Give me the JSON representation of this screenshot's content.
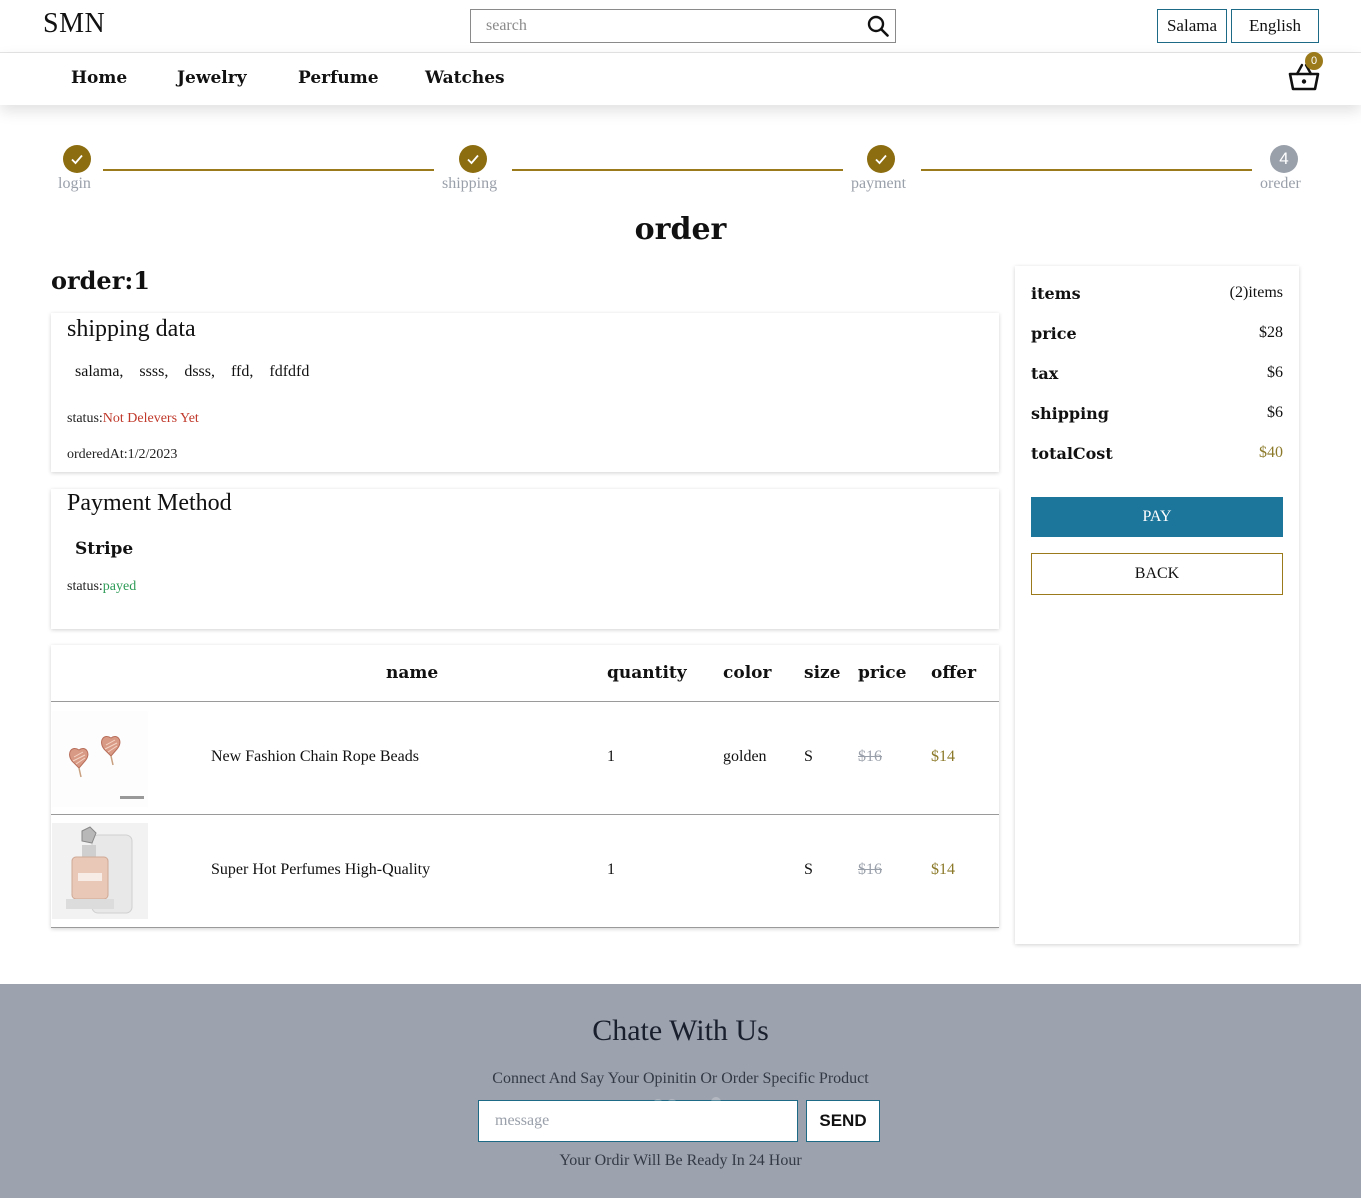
{
  "header": {
    "logo": "SMN",
    "search_placeholder": "search",
    "user_name": "Salama",
    "language": "English"
  },
  "nav": {
    "links": [
      "Home",
      "Jewelry",
      "Perfume",
      "Watches"
    ],
    "cart_count": "0"
  },
  "stepper": {
    "steps": [
      {
        "label": "login",
        "done": true
      },
      {
        "label": "shipping",
        "done": true
      },
      {
        "label": "payment",
        "done": true
      },
      {
        "label": "oreder",
        "done": false,
        "number": "4"
      }
    ]
  },
  "page_title": "order",
  "order_label": "order:1",
  "shipping": {
    "title": "shipping data",
    "address": [
      "salama,",
      "ssss,",
      "dsss,",
      "ffd,",
      "fdfdfd"
    ],
    "status_label": "status:",
    "status_value": "Not Delevers Yet",
    "ordered_at": "orderedAt:1/2/2023"
  },
  "payment": {
    "title": "Payment Method",
    "method": "Stripe",
    "status_label": "status:",
    "status_value": "payed"
  },
  "table": {
    "headers": {
      "name": "name",
      "quantity": "quantity",
      "color": "color",
      "size": "size",
      "price": "price",
      "offer": "offer"
    },
    "rows": [
      {
        "name": "New Fashion Chain Rope Beads",
        "quantity": "1",
        "color": "golden",
        "size": "S",
        "price": "$16",
        "offer": "$14",
        "image": "heart-earrings-image"
      },
      {
        "name": "Super Hot Perfumes High-Quality",
        "quantity": "1",
        "color": "",
        "size": "S",
        "price": "$16",
        "offer": "$14",
        "image": "perfume-bottle-image"
      }
    ]
  },
  "summary": {
    "rows": [
      {
        "key": "items",
        "value": "(2)items"
      },
      {
        "key": "price",
        "value": "$28"
      },
      {
        "key": "tax",
        "value": "$6"
      },
      {
        "key": "shipping",
        "value": "$6"
      },
      {
        "key": "totalCost",
        "value": "$40"
      }
    ],
    "pay_label": "PAY",
    "back_label": "BACK"
  },
  "footer": {
    "title": "Chate With Us",
    "subtitle": "Connect And Say Your Opinitin Or Order Specific Product",
    "message_placeholder": "message",
    "send_label": "SEND",
    "note": "Your Ordir Will Be Ready In 24 Hour"
  },
  "colors": {
    "accent_gold": "#8c6d0f",
    "pay_blue": "#1c769b",
    "footer_bg": "#9ca3ae",
    "status_red": "#c0392b",
    "status_green": "#2e9b57"
  }
}
